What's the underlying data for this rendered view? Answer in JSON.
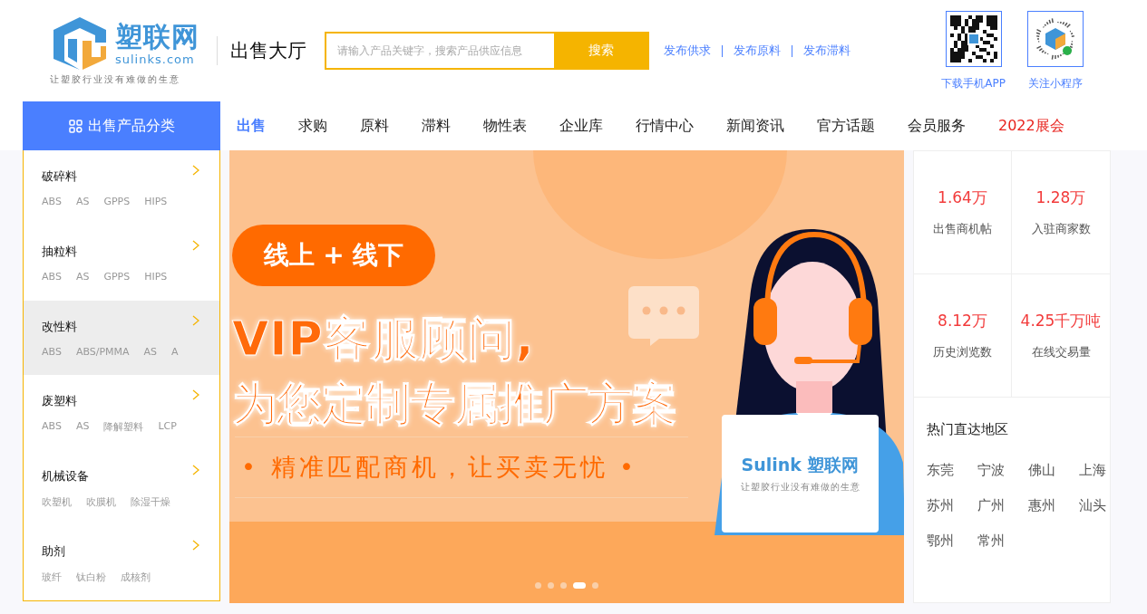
{
  "header": {
    "logo": {
      "name": "塑联网",
      "domain": "sulinks.com",
      "slogan": "让塑胶行业没有难做的生意"
    },
    "section_title": "出售大厅",
    "search": {
      "placeholder": "请输入产品关键字，搜索产品供应信息",
      "button": "搜索"
    },
    "quick_links": [
      "发布供求",
      "发布原料",
      "发布滞料"
    ],
    "qr_codes": [
      {
        "kind": "app",
        "caption": "下载手机APP"
      },
      {
        "kind": "miniprogram",
        "caption": "关注小程序"
      }
    ]
  },
  "nav": {
    "category_button": "出售产品分类",
    "items": [
      {
        "label": "出售",
        "selected": true,
        "highlight": false
      },
      {
        "label": "求购",
        "selected": false,
        "highlight": false
      },
      {
        "label": "原料",
        "selected": false,
        "highlight": false
      },
      {
        "label": "滞料",
        "selected": false,
        "highlight": false
      },
      {
        "label": "物性表",
        "selected": false,
        "highlight": false
      },
      {
        "label": "企业库",
        "selected": false,
        "highlight": false
      },
      {
        "label": "行情中心",
        "selected": false,
        "highlight": false
      },
      {
        "label": "新闻资讯",
        "selected": false,
        "highlight": false
      },
      {
        "label": "官方话题",
        "selected": false,
        "highlight": false
      },
      {
        "label": "会员服务",
        "selected": false,
        "highlight": false
      },
      {
        "label": "2022展会",
        "selected": false,
        "highlight": true
      }
    ]
  },
  "categories": [
    {
      "name": "破碎料",
      "selected": false,
      "tags": [
        "ABS",
        "AS",
        "GPPS",
        "HIPS"
      ]
    },
    {
      "name": "抽粒料",
      "selected": false,
      "tags": [
        "ABS",
        "AS",
        "GPPS",
        "HIPS"
      ]
    },
    {
      "name": "改性料",
      "selected": true,
      "tags": [
        "ABS",
        "ABS/PMMA",
        "AS",
        "A"
      ]
    },
    {
      "name": "废塑料",
      "selected": false,
      "tags": [
        "ABS",
        "AS",
        "降解塑料",
        "LCP"
      ]
    },
    {
      "name": "机械设备",
      "selected": false,
      "tags": [
        "吹塑机",
        "吹膜机",
        "除湿干燥"
      ]
    },
    {
      "name": "助剂",
      "selected": false,
      "tags": [
        "玻纤",
        "钛白粉",
        "成核剂"
      ]
    }
  ],
  "banner": {
    "pill": "线上 + 线下",
    "headline_1": "VIP客服顾问,",
    "headline_2": "为您定制专属推广方案",
    "subline": "• 精准匹配商机，让买卖无忧 •",
    "laptop_brand": "Sulink 塑联网",
    "laptop_slogan": "让塑胶行业没有难做的生意",
    "dots": [
      {
        "selected": false
      },
      {
        "selected": false
      },
      {
        "selected": false
      },
      {
        "selected": true
      },
      {
        "selected": false
      }
    ]
  },
  "stats": [
    {
      "value": "1.64万",
      "label": "出售商机帖"
    },
    {
      "value": "1.28万",
      "label": "入驻商家数"
    },
    {
      "value": "8.12万",
      "label": "历史浏览数"
    },
    {
      "value": "4.25千万吨",
      "label": "在线交易量"
    }
  ],
  "regions": {
    "title": "热门直达地区",
    "items": [
      "东莞",
      "宁波",
      "佛山",
      "上海",
      "苏州",
      "广州",
      "惠州",
      "汕头",
      "鄂州",
      "常州"
    ]
  }
}
